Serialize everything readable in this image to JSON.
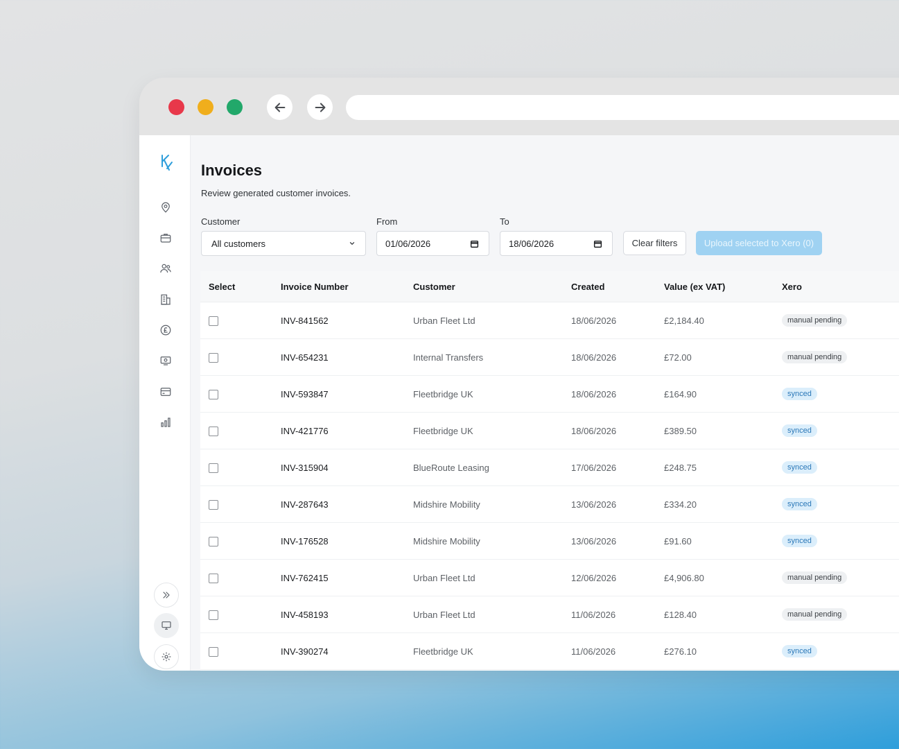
{
  "page": {
    "title": "Invoices",
    "subtitle": "Review generated customer invoices."
  },
  "filters": {
    "customer_label": "Customer",
    "customer_value": "All customers",
    "from_label": "From",
    "from_value": "01/06/2026",
    "to_label": "To",
    "to_value": "18/06/2026",
    "clear_label": "Clear filters",
    "upload_label": "Upload selected to Xero (0)"
  },
  "table": {
    "headers": [
      "Select",
      "Invoice Number",
      "Customer",
      "Created",
      "Value (ex VAT)",
      "Xero"
    ],
    "rows": [
      {
        "invoice": "INV-841562",
        "customer": "Urban Fleet Ltd",
        "created": "18/06/2026",
        "value": "£2,184.40",
        "xero": "manual pending"
      },
      {
        "invoice": "INV-654231",
        "customer": "Internal Transfers",
        "created": "18/06/2026",
        "value": "£72.00",
        "xero": "manual pending"
      },
      {
        "invoice": "INV-593847",
        "customer": "Fleetbridge UK",
        "created": "18/06/2026",
        "value": "£164.90",
        "xero": "synced"
      },
      {
        "invoice": "INV-421776",
        "customer": "Fleetbridge UK",
        "created": "18/06/2026",
        "value": "£389.50",
        "xero": "synced"
      },
      {
        "invoice": "INV-315904",
        "customer": "BlueRoute Leasing",
        "created": "17/06/2026",
        "value": "£248.75",
        "xero": "synced"
      },
      {
        "invoice": "INV-287643",
        "customer": "Midshire Mobility",
        "created": "13/06/2026",
        "value": "£334.20",
        "xero": "synced"
      },
      {
        "invoice": "INV-176528",
        "customer": "Midshire Mobility",
        "created": "13/06/2026",
        "value": "£91.60",
        "xero": "synced"
      },
      {
        "invoice": "INV-762415",
        "customer": "Urban Fleet Ltd",
        "created": "12/06/2026",
        "value": "£4,906.80",
        "xero": "manual pending"
      },
      {
        "invoice": "INV-458193",
        "customer": "Urban Fleet Ltd",
        "created": "11/06/2026",
        "value": "£128.40",
        "xero": "manual pending"
      },
      {
        "invoice": "INV-390274",
        "customer": "Fleetbridge UK",
        "created": "11/06/2026",
        "value": "£276.10",
        "xero": "synced"
      }
    ]
  },
  "icons": {
    "nav": [
      "location-icon",
      "briefcase-icon",
      "users-icon",
      "building-icon",
      "pound-icon",
      "monitor-money-icon",
      "card-icon",
      "bar-chart-icon"
    ],
    "bottom": [
      "double-chevron-right-icon",
      "monitor-icon",
      "settings-icon",
      "bell-icon",
      "logout-icon"
    ]
  },
  "colors": {
    "accent": "#2e9edb",
    "upload_button": "#9fd2f2",
    "synced_badge_bg": "#dbeefb",
    "synced_badge_text": "#2b78b8",
    "pending_badge_bg": "#eef0f2"
  }
}
